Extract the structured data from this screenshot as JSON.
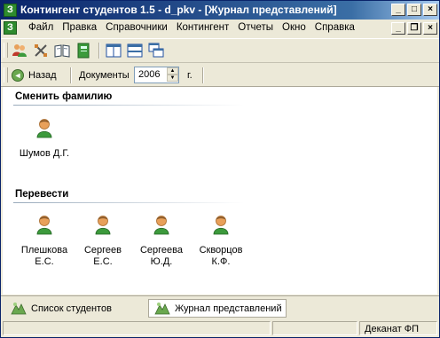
{
  "window": {
    "title": "Контингент студентов 1.5 - d_pkv - [Журнал представлений]",
    "app_icon_letter": "З",
    "caption_buttons": [
      "_",
      "□",
      "×"
    ]
  },
  "menubar": {
    "items": [
      "Файл",
      "Правка",
      "Справочники",
      "Контингент",
      "Отчеты",
      "Окно",
      "Справка"
    ],
    "mdi_buttons": [
      "_",
      "❐",
      "×"
    ]
  },
  "toolbar": {
    "icons": [
      "users-icon",
      "tools-icon",
      "book-icon",
      "notebook-icon",
      "layout-columns-icon",
      "layout-rows-icon",
      "cascade-windows-icon"
    ]
  },
  "navbar": {
    "back_label": "Назад",
    "documents_label": "Документы",
    "year_value": "2006",
    "year_suffix": "г."
  },
  "sections": [
    {
      "title": "Сменить фамилию",
      "people": [
        {
          "line1": "Шумов Д.Г.",
          "line2": ""
        }
      ]
    },
    {
      "title": "Перевести",
      "people": [
        {
          "line1": "Плешкова",
          "line2": "Е.С."
        },
        {
          "line1": "Сергеев",
          "line2": "Е.С."
        },
        {
          "line1": "Сергеева",
          "line2": "Ю.Д."
        },
        {
          "line1": "Скворцов",
          "line2": "К.Ф."
        }
      ]
    }
  ],
  "tabs": [
    {
      "label": "Список студентов",
      "active": false
    },
    {
      "label": "Журнал представлений",
      "active": true
    }
  ],
  "statusbar": {
    "right_text": "Деканат ФП"
  },
  "colors": {
    "titlebar_start": "#0a246a",
    "person_skin": "#e8a05a",
    "person_shirt": "#3c9a3c",
    "window_bg": "#ece9d8"
  }
}
